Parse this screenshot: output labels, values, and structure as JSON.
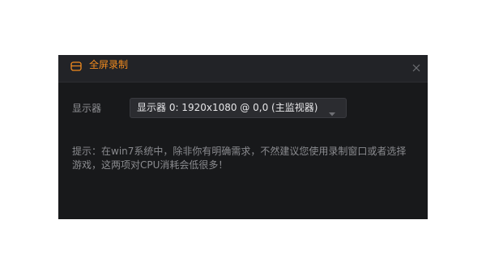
{
  "window": {
    "title": "全屏录制",
    "icon": "monitor-icon",
    "accent_color": "#f28b1e",
    "close_icon": "close-icon"
  },
  "display_setting": {
    "label": "显示器",
    "selected": "显示器 0: 1920x1080 @ 0,0 (主监视器)",
    "chevron_icon": "chevron-down-icon"
  },
  "hint": {
    "line1": "提示：在win7系统中，除非你有明确需求，不然建议您使用录制窗口或者选择",
    "line2": "游戏，这两项对CPU消耗会低很多！"
  }
}
